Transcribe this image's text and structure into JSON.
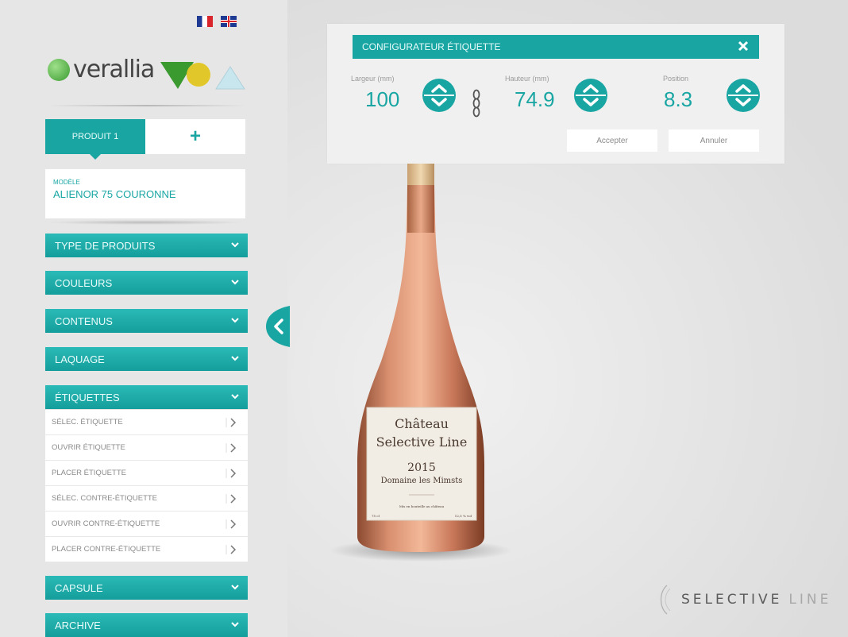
{
  "sidebar": {
    "logo_text": "verallia",
    "product_tabs": [
      {
        "label": "PRODUIT 1"
      },
      {
        "label": "+"
      }
    ],
    "model": {
      "label": "MODÈLE",
      "value": "ALIENOR 75 COURONNE"
    },
    "menu": [
      {
        "label": "TYPE DE PRODUITS"
      },
      {
        "label": "COULEURS"
      },
      {
        "label": "CONTENUS"
      },
      {
        "label": "LAQUAGE"
      },
      {
        "label": "ÉTIQUETTES"
      },
      {
        "label": "CAPSULE"
      },
      {
        "label": "ARCHIVE"
      }
    ],
    "etiquettes_sub": [
      {
        "label": "SÉLEC. ÉTIQUETTE"
      },
      {
        "label": "OUVRIR ÉTIQUETTE"
      },
      {
        "label": "PLACER ÉTIQUETTE"
      },
      {
        "label": "SÉLEC. CONTRE-ÉTIQUETTE"
      },
      {
        "label": "OUVRIR CONTRE-ÉTIQUETTE"
      },
      {
        "label": "PLACER CONTRE-ÉTIQUETTE"
      }
    ]
  },
  "config": {
    "title": "CONFIGURATEUR ÉTIQUETTE",
    "largeur_label": "Largeur (mm)",
    "largeur_value": "100",
    "hauteur_label": "Hauteur (mm)",
    "hauteur_value": "74.9",
    "position_label": "Position",
    "position_value": "8.3",
    "accept_label": "Accepter",
    "cancel_label": "Annuler"
  },
  "bottle_label": {
    "line1": "Château",
    "line2": "Selective Line",
    "year": "2015",
    "domain": "Domaine les Mimsts",
    "small": "Mis en bouteille au château",
    "left_vol": "75 cl",
    "right_vol": "12,5 % vol"
  },
  "brand": {
    "part1": "SELECTIVE",
    "part2": "LINE"
  },
  "colors": {
    "teal": "#19a6a3",
    "sidebar_bg": "#e6e6e6",
    "bottle": "#d4876a"
  }
}
